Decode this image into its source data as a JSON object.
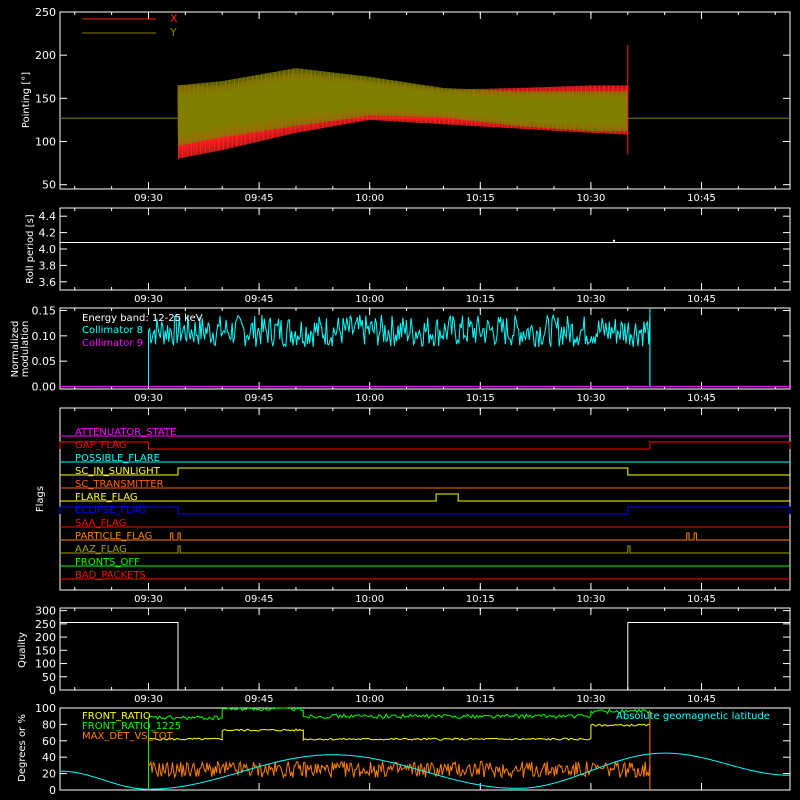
{
  "time_ticks": [
    "09:30",
    "09:45",
    "10:00",
    "10:15",
    "10:30",
    "10:45"
  ],
  "colors": {
    "axis": "#ffffff",
    "x": "#ff2020",
    "y": "#808000",
    "cyan": "#00ffff",
    "magenta": "#ff00ff",
    "yellow": "#ffff00",
    "green": "#00ff00",
    "orange": "#ff8000",
    "red": "#ff0000",
    "blue": "#0000ff",
    "olive": "#a0a000"
  },
  "chart_data": [
    {
      "type": "line",
      "ylabel": "Pointing [°]",
      "ylim": [
        45,
        250
      ],
      "yticks": [
        "50",
        "100",
        "150",
        "200",
        "250"
      ],
      "xlim": [
        "09:18",
        "10:57"
      ],
      "series": [
        {
          "name": "X",
          "color": "#ff2020",
          "x_start": "09:34",
          "x_end": "10:35",
          "envelope_time": [
            "09:34",
            "09:40",
            "09:50",
            "10:00",
            "10:10",
            "10:20",
            "10:30",
            "10:35"
          ],
          "upper": [
            165,
            165,
            180,
            170,
            160,
            162,
            165,
            165
          ],
          "lower": [
            80,
            90,
            110,
            125,
            120,
            115,
            110,
            108
          ]
        },
        {
          "name": "Y",
          "color": "#808000",
          "x_start": "09:34",
          "x_end": "10:35",
          "envelope_time": [
            "09:34",
            "09:40",
            "09:50",
            "10:00",
            "10:10",
            "10:20",
            "10:30",
            "10:35"
          ],
          "upper": [
            165,
            170,
            185,
            175,
            162,
            158,
            158,
            158
          ],
          "lower": [
            95,
            105,
            118,
            130,
            128,
            118,
            112,
            112
          ]
        }
      ],
      "baseline": 127,
      "spike_time": "10:35",
      "spike_range": [
        85,
        212
      ]
    },
    {
      "type": "line",
      "ylabel": "Roll period [s]",
      "ylim": [
        3.5,
        4.5
      ],
      "yticks": [
        "3.6",
        "3.8",
        "4.0",
        "4.2",
        "4.4"
      ],
      "series": [
        {
          "name": "",
          "values_constant": 4.08
        }
      ],
      "marker": {
        "time": "10:33",
        "value": 4.1
      }
    },
    {
      "type": "line",
      "ylabel": "Normalized modulation",
      "ylim": [
        -0.005,
        0.155
      ],
      "yticks": [
        "0.00",
        "0.05",
        "0.10",
        "0.15"
      ],
      "annotations": [
        "Energy band: 12-25 keV",
        "Collimator 8",
        "Collimator 9"
      ],
      "series": [
        {
          "name": "Collimator 8",
          "color": "#00ffff",
          "x_start": "09:30",
          "x_end": "10:38",
          "mean": 0.11,
          "noise": 0.02
        },
        {
          "name": "Collimator 9",
          "color": "#ff00ff",
          "values_constant": 0.0
        }
      ]
    },
    {
      "type": "line",
      "ylabel": "Flags",
      "flags": [
        {
          "name": "ATTENUATOR_STATE",
          "color": "#ff00ff",
          "segments": []
        },
        {
          "name": "GAP_FLAG",
          "color": "#ff0000",
          "segments": [
            [
              "09:18",
              "09:30"
            ],
            [
              "10:38",
              "10:57"
            ]
          ]
        },
        {
          "name": "POSSIBLE_FLARE",
          "color": "#00ffff",
          "segments": []
        },
        {
          "name": "SC_IN_SUNLIGHT",
          "color": "#ffff00",
          "segments": [
            [
              "09:34",
              "10:35"
            ]
          ]
        },
        {
          "name": "SC_TRANSMITTER",
          "color": "#ff6000",
          "segments": []
        },
        {
          "name": "FLARE_FLAG",
          "color": "#ffff00",
          "segments": [
            [
              "10:09",
              "10:12"
            ]
          ]
        },
        {
          "name": "ECLIPSE_FLAG",
          "color": "#0000ff",
          "segments": [
            [
              "09:18",
              "09:34"
            ],
            [
              "10:35",
              "10:57"
            ]
          ]
        },
        {
          "name": "SAA_FLAG",
          "color": "#ff0000",
          "segments": []
        },
        {
          "name": "PARTICLE_FLAG",
          "color": "#ff8000",
          "segments": [
            [
              "09:33",
              "09:33.3"
            ],
            [
              "09:34",
              "09:34.3"
            ],
            [
              "10:43",
              "10:43.3"
            ],
            [
              "10:44",
              "10:44.3"
            ]
          ]
        },
        {
          "name": "AAZ_FLAG",
          "color": "#a0a000",
          "segments": [
            [
              "09:34",
              "09:34.3"
            ],
            [
              "10:35",
              "10:35.3"
            ]
          ]
        },
        {
          "name": "FRONTS_OFF",
          "color": "#00ff00",
          "segments": []
        },
        {
          "name": "BAD_PACKETS",
          "color": "#ff0000",
          "segments": []
        }
      ]
    },
    {
      "type": "line",
      "ylabel": "Quality",
      "ylim": [
        0,
        310
      ],
      "yticks": [
        "0",
        "50",
        "100",
        "150",
        "200",
        "250",
        "300"
      ],
      "series": [
        {
          "name": "",
          "color": "#ffffff",
          "steps": [
            [
              "09:18",
              "09:34",
              255
            ],
            [
              "09:34",
              "10:35",
              0
            ],
            [
              "10:35",
              "10:57",
              255
            ]
          ]
        }
      ]
    },
    {
      "type": "line",
      "ylabel": "Degrees or %",
      "ylim": [
        0,
        100
      ],
      "yticks": [
        "0",
        "20",
        "40",
        "60",
        "80",
        "100"
      ],
      "legend_left": [
        "FRONT_RATIO",
        "FRONT_RATIO_1225",
        "MAX_DET_VS_TOT"
      ],
      "legend_right": "Absolute geomagnetic latitude",
      "series": [
        {
          "name": "FRONT_RATIO",
          "color": "#ffff00",
          "steps": [
            [
              "09:30",
              "09:40",
              62
            ],
            [
              "09:40",
              "09:51",
              73
            ],
            [
              "09:51",
              "10:30",
              62
            ],
            [
              "10:30",
              "10:38",
              79
            ]
          ]
        },
        {
          "name": "FRONT_RATIO_1225",
          "color": "#00ff00",
          "steps": [
            [
              "09:30",
              "09:40",
              88
            ],
            [
              "09:40",
              "09:51",
              99
            ],
            [
              "09:51",
              "10:30",
              90
            ],
            [
              "10:30",
              "10:38",
              96
            ]
          ]
        },
        {
          "name": "MAX_DET_VS_TOT",
          "color": "#ff8000",
          "x_start": "09:30",
          "x_end": "10:38",
          "mean": 25,
          "noise": 10
        },
        {
          "name": "Absolute geomagnetic latitude",
          "color": "#00ffff",
          "points": [
            [
              "09:18",
              23
            ],
            [
              "09:30",
              1
            ],
            [
              "09:55",
              43
            ],
            [
              "10:20",
              2
            ],
            [
              "10:40",
              45
            ],
            [
              "10:57",
              18
            ]
          ]
        }
      ]
    }
  ]
}
